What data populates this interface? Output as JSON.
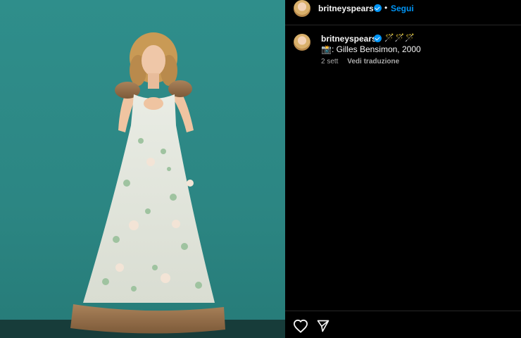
{
  "post": {
    "username": "britneyspears",
    "follow_label": "Segui",
    "separator": "•",
    "caption_emojis": "🪄🪄🪄",
    "caption_text": "📸: Gilles Bensimon, 2000",
    "timestamp": "2 sett",
    "translate_label": "Vedi traduzione"
  },
  "icons": {
    "like": "heart-icon",
    "share": "paper-plane-icon",
    "verified": "verified-badge-icon"
  },
  "colors": {
    "accent": "#0095f6",
    "background": "#000000",
    "photo_backdrop": "#2c8683"
  }
}
